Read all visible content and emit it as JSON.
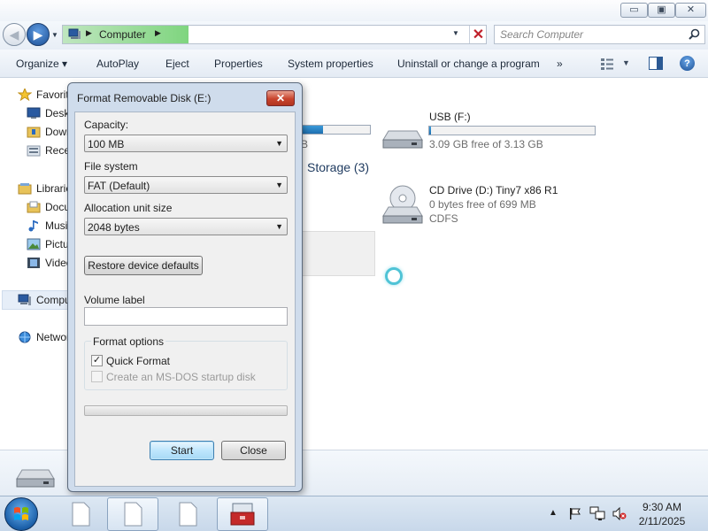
{
  "window": {
    "buttons": {
      "minimize": "▭",
      "maximize": "▣",
      "close": "✕"
    }
  },
  "address": {
    "location": "Computer",
    "search_placeholder": "Search Computer"
  },
  "toolbar": {
    "organize": "Organize ▾",
    "autoplay": "AutoPlay",
    "eject": "Eject",
    "properties": "Properties",
    "system_properties": "System properties",
    "uninstall": "Uninstall or change a program",
    "more": "»"
  },
  "nav_pane": {
    "items": [
      {
        "label": "Favorites",
        "icon": "star-icon"
      },
      {
        "label": "Desktop",
        "icon": "desktop-icon"
      },
      {
        "label": "Downloads",
        "icon": "downloads-folder-icon"
      },
      {
        "label": "Recent Places",
        "icon": "recent-places-icon"
      },
      {
        "label": "Libraries",
        "icon": "libraries-icon"
      },
      {
        "label": "Documents",
        "icon": "documents-icon"
      },
      {
        "label": "Music",
        "icon": "music-icon"
      },
      {
        "label": "Pictures",
        "icon": "pictures-icon"
      },
      {
        "label": "Videos",
        "icon": "videos-icon"
      },
      {
        "label": "Computer",
        "icon": "computer-icon"
      },
      {
        "label": "Network",
        "icon": "network-icon"
      }
    ]
  },
  "content": {
    "partial_size_text": "B",
    "local_drive_fill": 0.45,
    "usb": {
      "name": "USB (F:)",
      "free": "3.09 GB free of 3.13 GB",
      "fill": 0.01
    },
    "group_header": "Storage (3)",
    "cd": {
      "name": "CD Drive (D:) Tiny7 x86 R1",
      "free": "0 bytes free of 699 MB",
      "fs": "CDFS"
    }
  },
  "dialog": {
    "title": "Format Removable Disk (E:)",
    "close": "✕",
    "capacity_label": "Capacity:",
    "capacity_value": "100 MB",
    "filesystem_label": "File system",
    "filesystem_value": "FAT (Default)",
    "allocation_label": "Allocation unit size",
    "allocation_value": "2048 bytes",
    "restore_button": "Restore device defaults",
    "volume_label": "Volume label",
    "volume_value": "",
    "format_options_label": "Format options",
    "quick_format": "Quick Format",
    "quick_format_checked": "✓",
    "msdos_startup": "Create an MS-DOS startup disk",
    "progress": 0,
    "start_button": "Start",
    "close_button": "Close"
  },
  "taskbar": {
    "time": "9:30 AM",
    "date": "2/11/2025"
  }
}
